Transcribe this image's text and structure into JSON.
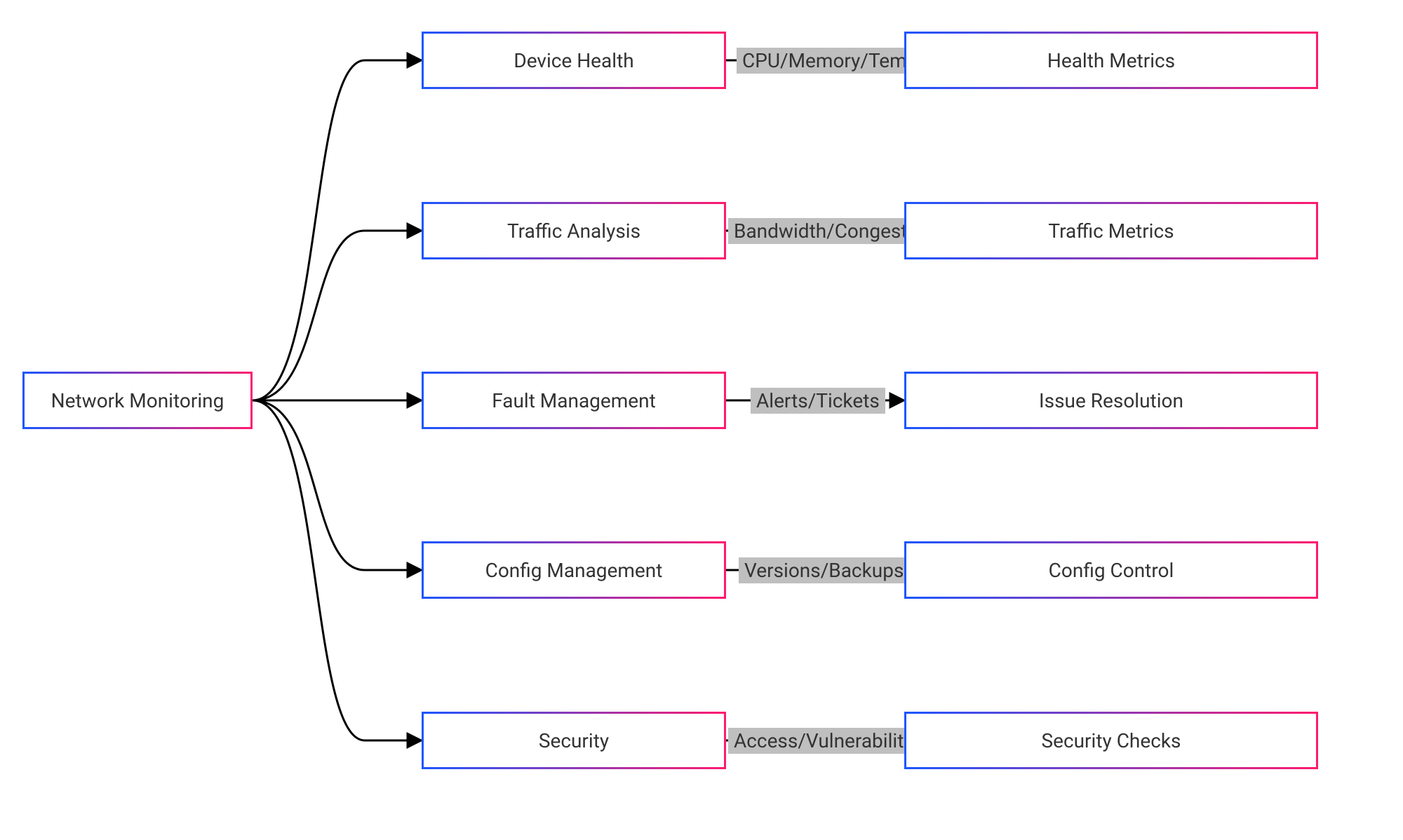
{
  "root": {
    "label": "Network Monitoring"
  },
  "branches": [
    {
      "mid": "Device Health",
      "edge": "CPU/Memory/Temp",
      "leaf": "Health Metrics"
    },
    {
      "mid": "Traffic Analysis",
      "edge": "Bandwidth/Congestion",
      "leaf": "Traffic Metrics"
    },
    {
      "mid": "Fault Management",
      "edge": "Alerts/Tickets",
      "leaf": "Issue Resolution"
    },
    {
      "mid": "Config Management",
      "edge": "Versions/Backups",
      "leaf": "Config Control"
    },
    {
      "mid": "Security",
      "edge": "Access/Vulnerabilities",
      "leaf": "Security Checks"
    }
  ]
}
